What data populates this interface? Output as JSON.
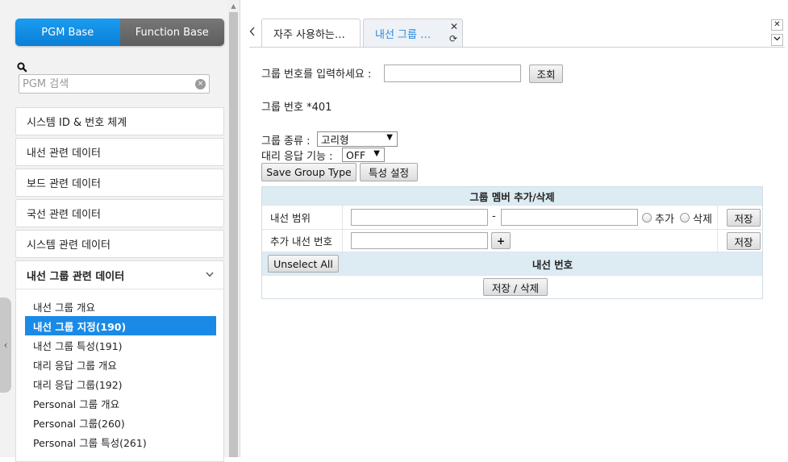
{
  "sidebar": {
    "mode_toggle": {
      "pgm": "PGM Base",
      "function": "Function Base"
    },
    "search": {
      "placeholder": "PGM 검색",
      "clear": "×"
    },
    "menu": [
      {
        "label": "시스템 ID & 번호 체계"
      },
      {
        "label": "내선 관련 데이터"
      },
      {
        "label": "보드 관련 데이터"
      },
      {
        "label": "국선 관련 데이터"
      },
      {
        "label": "시스템 관련 데이터"
      }
    ],
    "open_group": {
      "label": "내선 그룹 관련 데이터",
      "items": [
        {
          "label": "내선 그룹 개요"
        },
        {
          "label": "내선 그룹 지정(190)",
          "active": true
        },
        {
          "label": "내선 그룹 특성(191)"
        },
        {
          "label": "대리 응답 그룹 개요"
        },
        {
          "label": "대리 응답 그룹(192)"
        },
        {
          "label": "Personal 그룹 개요"
        },
        {
          "label": "Personal 그룹(260)"
        },
        {
          "label": "Personal 그룹 특성(261)"
        }
      ]
    },
    "collapse_arrow": "‹"
  },
  "tabs": [
    {
      "label": "자주 사용하는…"
    },
    {
      "label": "내선 그룹 …",
      "active": true
    }
  ],
  "main": {
    "group_number_prompt": "그룹 번호를 입력하세요 :",
    "lookup_button": "조회",
    "group_number_display": "그룹 번호 *401",
    "group_type_label": "그룹 종류 :",
    "group_type_value": "고리형",
    "pickup_label": "대리 응답 기능 :",
    "pickup_value": "OFF",
    "save_group_type_button": "Save Group Type",
    "property_button": "특성 설정",
    "member_table": {
      "title": "그룹 멤버 추가/삭제",
      "range_label": "내선 범위",
      "range_dash": "-",
      "radio_add": "추가",
      "radio_delete": "삭제",
      "save_button": "저장",
      "add_ext_label": "추가 내선 번호",
      "plus_button": "+",
      "unselect_all_button": "Unselect All",
      "ext_number_header": "내선 번호",
      "save_delete_button": "저장 / 삭제"
    }
  },
  "colors": {
    "accent": "#1a8ae6",
    "table_header": "#ddebf3",
    "function_button": "#666666"
  }
}
